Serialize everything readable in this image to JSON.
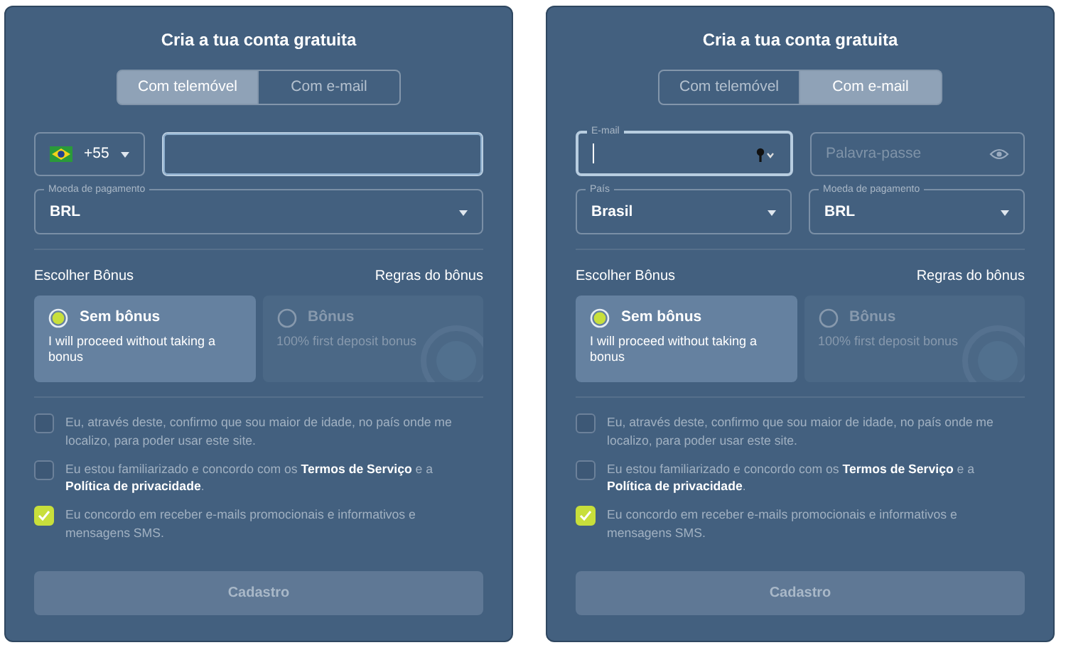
{
  "panels": [
    {
      "title": "Cria a tua conta gratuita",
      "tabs": [
        {
          "label": "Com telemóvel",
          "selected": true
        },
        {
          "label": "Com e-mail",
          "selected": false
        }
      ],
      "field_rows": [
        [
          {
            "kind": "phone",
            "code": "+55",
            "focused": true
          }
        ],
        [
          {
            "kind": "select",
            "label": "Moeda de pagamento",
            "value": "BRL",
            "focused": false
          }
        ]
      ],
      "bonus_heading": "Escolher Bônus",
      "bonus_rules_link": "Regras do bônus",
      "bonus_options": [
        {
          "title": "Sem bônus",
          "description": "I will proceed without taking a bonus",
          "selected": true
        },
        {
          "title": "Bônus",
          "description": "100% first deposit bonus",
          "selected": false
        }
      ],
      "consents": [
        {
          "text": "Eu, através deste, confirmo que sou maior de idade, no país onde me localizo, para poder usar este site.",
          "checked": false
        },
        {
          "text": "Eu estou familiarizado e concordo com os **Termos de Serviço** e a **Política de privacidade**.",
          "checked": false
        },
        {
          "text": "Eu concordo em receber e-mails promocionais e informativos e mensagens SMS.",
          "checked": true
        }
      ],
      "submit": {
        "label": "Cadastro",
        "disabled": true
      }
    },
    {
      "title": "Cria a tua conta gratuita",
      "tabs": [
        {
          "label": "Com telemóvel",
          "selected": false
        },
        {
          "label": "Com e-mail",
          "selected": true
        }
      ],
      "field_rows": [
        [
          {
            "kind": "email",
            "label": "E-mail",
            "focused": true
          },
          {
            "kind": "password",
            "placeholder": "Palavra-passe",
            "focused": false
          }
        ],
        [
          {
            "kind": "select",
            "label": "País",
            "value": "Brasil",
            "focused": false
          },
          {
            "kind": "select",
            "label": "Moeda de pagamento",
            "value": "BRL",
            "focused": false
          }
        ]
      ],
      "bonus_heading": "Escolher Bônus",
      "bonus_rules_link": "Regras do bônus",
      "bonus_options": [
        {
          "title": "Sem bônus",
          "description": "I will proceed without taking a bonus",
          "selected": true
        },
        {
          "title": "Bônus",
          "description": "100% first deposit bonus",
          "selected": false
        }
      ],
      "consents": [
        {
          "text": "Eu, através deste, confirmo que sou maior de idade, no país onde me localizo, para poder usar este site.",
          "checked": false
        },
        {
          "text": "Eu estou familiarizado e concordo com os **Termos de Serviço** e a **Política de privacidade**.",
          "checked": false
        },
        {
          "text": "Eu concordo em receber e-mails promocionais e informativos e mensagens SMS.",
          "checked": true
        }
      ],
      "submit": {
        "label": "Cadastro",
        "disabled": true
      }
    }
  ]
}
